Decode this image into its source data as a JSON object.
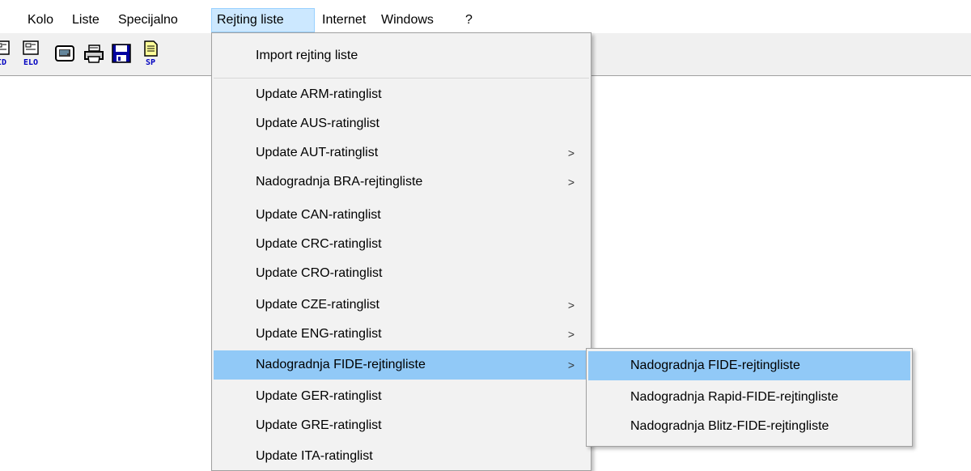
{
  "menubar": {
    "items": [
      "Kolo",
      "Liste",
      "Specijalno",
      "Rejting liste",
      "Internet",
      "Windows",
      "?"
    ]
  },
  "toolbar": {
    "buttons": [
      {
        "icon": "id-card-icon",
        "caption": "ID"
      },
      {
        "icon": "elo-card-icon",
        "caption": "ELO"
      },
      {
        "icon": "monitor-icon",
        "caption": ""
      },
      {
        "icon": "printer-icon",
        "caption": ""
      },
      {
        "icon": "floppy-disk-icon",
        "caption": ""
      },
      {
        "icon": "sp-document-icon",
        "caption": "SP"
      }
    ]
  },
  "rating_menu": {
    "items": [
      {
        "label": "Import rejting liste",
        "submenu": false
      },
      {
        "label": "Update ARM-ratinglist",
        "submenu": false
      },
      {
        "label": "Update AUS-ratinglist",
        "submenu": false
      },
      {
        "label": "Update AUT-ratinglist",
        "submenu": true
      },
      {
        "label": "Nadogradnja BRA-rejtingliste",
        "submenu": true
      },
      {
        "label": "Update CAN-ratinglist",
        "submenu": false
      },
      {
        "label": "Update CRC-ratinglist",
        "submenu": false
      },
      {
        "label": "Update CRO-ratinglist",
        "submenu": false
      },
      {
        "label": "Update CZE-ratinglist",
        "submenu": true
      },
      {
        "label": "Update ENG-ratinglist",
        "submenu": true
      },
      {
        "label": "Nadogradnja FIDE-rejtingliste",
        "submenu": true,
        "highlighted": true
      },
      {
        "label": "Update GER-ratinglist",
        "submenu": false
      },
      {
        "label": "Update GRE-ratinglist",
        "submenu": false
      },
      {
        "label": "Update ITA-ratinglist",
        "submenu": false
      }
    ],
    "arrow": ">"
  },
  "fide_submenu": {
    "items": [
      {
        "label": "Nadogradnja FIDE-rejtingliste",
        "highlighted": true
      },
      {
        "label": "Nadogradnja Rapid-FIDE-rejtingliste"
      },
      {
        "label": "Nadogradnja Blitz-FIDE-rejtingliste"
      }
    ]
  },
  "colors": {
    "menu_highlight": "#91c9f7",
    "menubar_open": "#cce8ff",
    "icon_blue": "#0000c0"
  }
}
